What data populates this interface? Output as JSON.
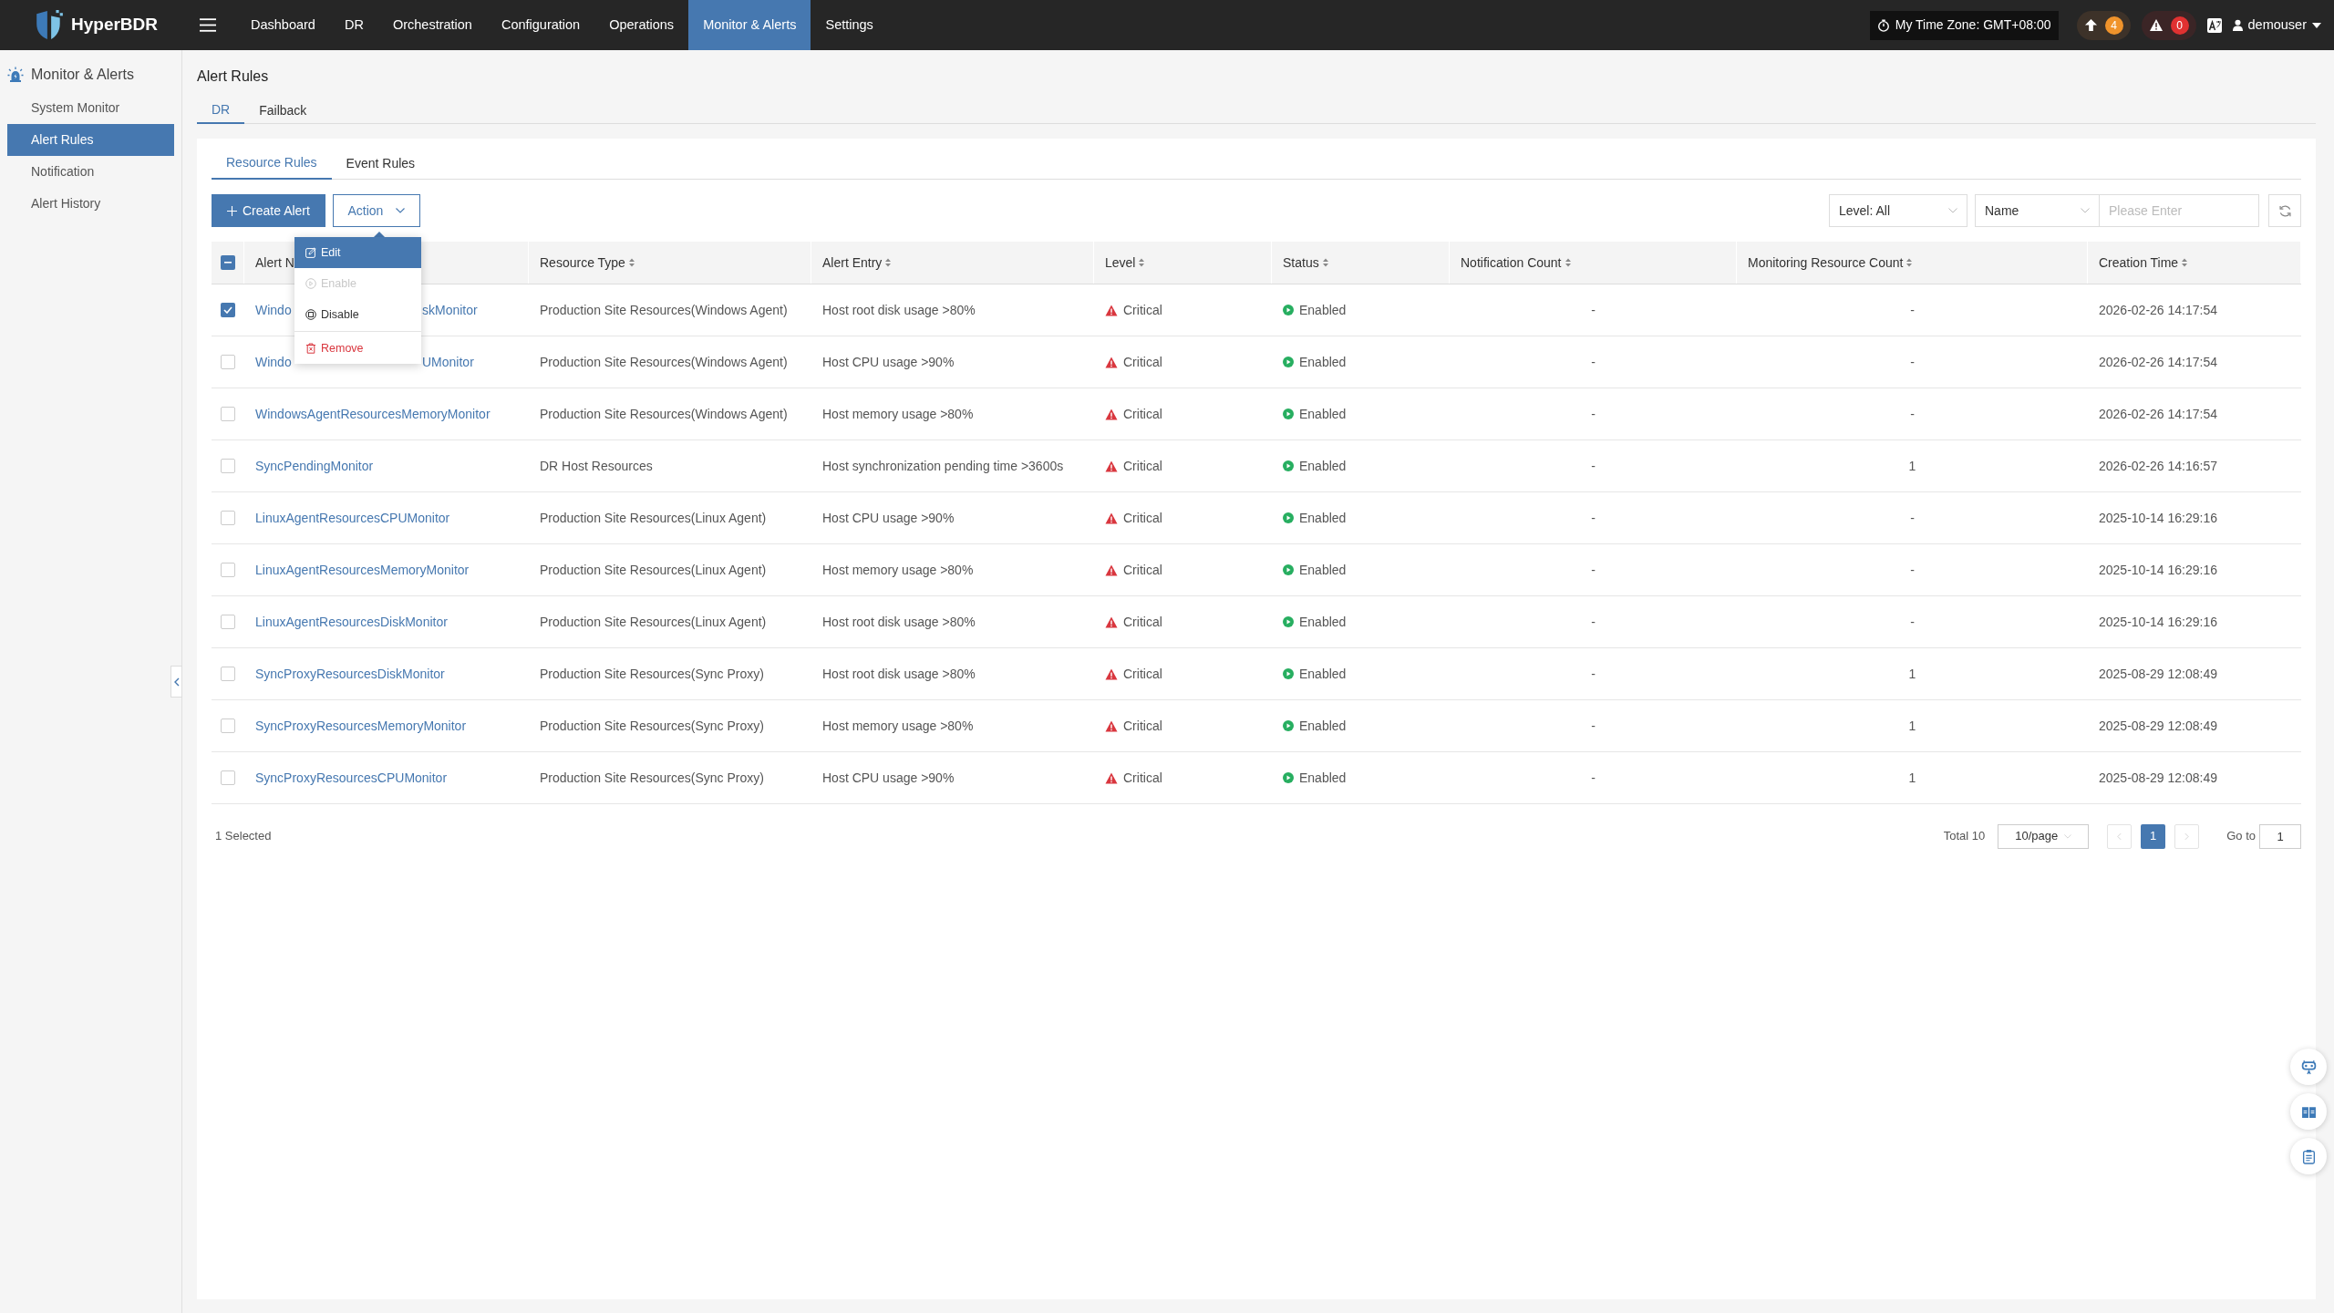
{
  "app": {
    "name": "HyperBDR"
  },
  "nav": [
    {
      "label": "Dashboard",
      "selected": false
    },
    {
      "label": "DR",
      "selected": false
    },
    {
      "label": "Orchestration",
      "selected": false
    },
    {
      "label": "Configuration",
      "selected": false
    },
    {
      "label": "Operations",
      "selected": false
    },
    {
      "label": "Monitor & Alerts",
      "selected": true
    },
    {
      "label": "Settings",
      "selected": false
    }
  ],
  "header": {
    "time_zone": "My Time Zone: GMT+08:00",
    "badges": [
      {
        "kind": "upload",
        "count": "4",
        "color": "#f0932b"
      },
      {
        "kind": "alert",
        "count": "0",
        "color": "#e03131"
      }
    ],
    "user": "demouser"
  },
  "sidebar": {
    "title": "Monitor & Alerts",
    "items": [
      {
        "label": "System Monitor",
        "selected": false
      },
      {
        "label": "Alert Rules",
        "selected": true
      },
      {
        "label": "Notification",
        "selected": false
      },
      {
        "label": "Alert History",
        "selected": false
      }
    ]
  },
  "page_title": "Alert Rules",
  "tabs": [
    {
      "label": "DR",
      "selected": true
    },
    {
      "label": "Failback",
      "selected": false
    }
  ],
  "subtabs": [
    {
      "label": "Resource Rules",
      "selected": true
    },
    {
      "label": "Event Rules",
      "selected": false
    }
  ],
  "toolbar": {
    "create_button": "Create Alert",
    "action_button": "Action",
    "level_filter": "Level: All",
    "field_select": "Name",
    "search": {
      "placeholder": "Please Enter"
    }
  },
  "action_menu": [
    {
      "kind": "edit",
      "label": "Edit",
      "highlighted": true,
      "disabled": false
    },
    {
      "kind": "enable",
      "label": "Enable",
      "highlighted": false,
      "disabled": true
    },
    {
      "kind": "disable",
      "label": "Disable",
      "highlighted": false,
      "disabled": false
    },
    {
      "kind": "remove",
      "label": "Remove",
      "highlighted": false,
      "disabled": false
    }
  ],
  "table": {
    "select_all": {
      "indeterminate": true
    },
    "columns": [
      {
        "label": "Alert N"
      },
      {
        "label": "Resource Type"
      },
      {
        "label": "Alert Entry"
      },
      {
        "label": "Level"
      },
      {
        "label": "Status"
      },
      {
        "label": "Notification Count"
      },
      {
        "label": "Monitoring Resource Count"
      },
      {
        "label": "Creation Time"
      }
    ],
    "rows": [
      {
        "selected": true,
        "name": [
          "Windo",
          "skMonitor"
        ],
        "resource_type": "Production Site Resources(Windows Agent)",
        "alert_entry": "Host root disk usage >80%",
        "level": "Critical",
        "status": "Enabled",
        "notification_count": "-",
        "monitoring_resource_count": "-",
        "creation_time": "2026-02-26 14:17:54"
      },
      {
        "selected": false,
        "name": [
          "Windo",
          "UMonitor"
        ],
        "resource_type": "Production Site Resources(Windows Agent)",
        "alert_entry": "Host CPU usage >90%",
        "level": "Critical",
        "status": "Enabled",
        "notification_count": "-",
        "monitoring_resource_count": "-",
        "creation_time": "2026-02-26 14:17:54"
      },
      {
        "selected": false,
        "name": [
          "WindowsAgentResourcesMemoryMonitor"
        ],
        "resource_type": "Production Site Resources(Windows Agent)",
        "alert_entry": "Host memory usage >80%",
        "level": "Critical",
        "status": "Enabled",
        "notification_count": "-",
        "monitoring_resource_count": "-",
        "creation_time": "2026-02-26 14:17:54"
      },
      {
        "selected": false,
        "name": [
          "SyncPendingMonitor"
        ],
        "resource_type": "DR Host Resources",
        "alert_entry": "Host synchronization pending time >3600s",
        "level": "Critical",
        "status": "Enabled",
        "notification_count": "-",
        "monitoring_resource_count": "1",
        "creation_time": "2026-02-26 14:16:57"
      },
      {
        "selected": false,
        "name": [
          "LinuxAgentResourcesCPUMonitor"
        ],
        "resource_type": "Production Site Resources(Linux Agent)",
        "alert_entry": "Host CPU usage >90%",
        "level": "Critical",
        "status": "Enabled",
        "notification_count": "-",
        "monitoring_resource_count": "-",
        "creation_time": "2025-10-14 16:29:16"
      },
      {
        "selected": false,
        "name": [
          "LinuxAgentResourcesMemoryMonitor"
        ],
        "resource_type": "Production Site Resources(Linux Agent)",
        "alert_entry": "Host memory usage >80%",
        "level": "Critical",
        "status": "Enabled",
        "notification_count": "-",
        "monitoring_resource_count": "-",
        "creation_time": "2025-10-14 16:29:16"
      },
      {
        "selected": false,
        "name": [
          "LinuxAgentResourcesDiskMonitor"
        ],
        "resource_type": "Production Site Resources(Linux Agent)",
        "alert_entry": "Host root disk usage >80%",
        "level": "Critical",
        "status": "Enabled",
        "notification_count": "-",
        "monitoring_resource_count": "-",
        "creation_time": "2025-10-14 16:29:16"
      },
      {
        "selected": false,
        "name": [
          "SyncProxyResourcesDiskMonitor"
        ],
        "resource_type": "Production Site Resources(Sync Proxy)",
        "alert_entry": "Host root disk usage >80%",
        "level": "Critical",
        "status": "Enabled",
        "notification_count": "-",
        "monitoring_resource_count": "1",
        "creation_time": "2025-08-29 12:08:49"
      },
      {
        "selected": false,
        "name": [
          "SyncProxyResourcesMemoryMonitor"
        ],
        "resource_type": "Production Site Resources(Sync Proxy)",
        "alert_entry": "Host memory usage >80%",
        "level": "Critical",
        "status": "Enabled",
        "notification_count": "-",
        "monitoring_resource_count": "1",
        "creation_time": "2025-08-29 12:08:49"
      },
      {
        "selected": false,
        "name": [
          "SyncProxyResourcesCPUMonitor"
        ],
        "resource_type": "Production Site Resources(Sync Proxy)",
        "alert_entry": "Host CPU usage >90%",
        "level": "Critical",
        "status": "Enabled",
        "notification_count": "-",
        "monitoring_resource_count": "1",
        "creation_time": "2025-08-29 12:08:49"
      }
    ]
  },
  "footer": {
    "selected_text": "1 Selected",
    "total": "Total 10",
    "page_size": "10/page",
    "pages": [
      {
        "label": "1",
        "selected": true
      }
    ],
    "goto_label": "Go to",
    "goto_value": "1"
  }
}
